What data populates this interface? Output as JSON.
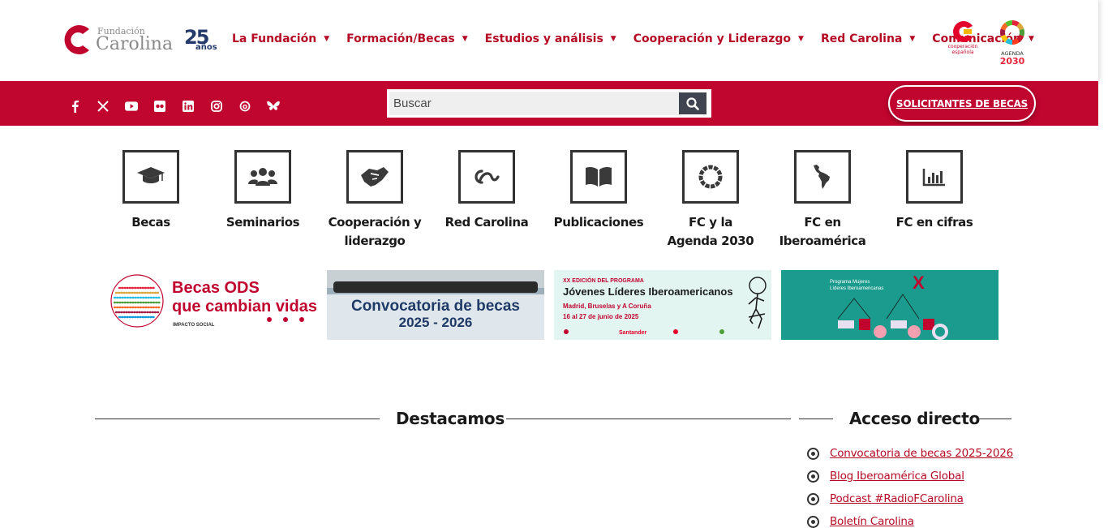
{
  "colors": {
    "brand_red": "#c0052f",
    "nav_red": "#b50b24",
    "dark": "#1a1a1a",
    "search_button": "#3f4450"
  },
  "header": {
    "logo": {
      "small": "Fundación",
      "big": "Carolina"
    },
    "anniversary": {
      "number": "25",
      "word": "años"
    },
    "nav": [
      {
        "label": "La Fundación",
        "icon": "caret-down-icon"
      },
      {
        "label": "Formación/Becas",
        "icon": "caret-down-icon"
      },
      {
        "label": "Estudios y análisis",
        "icon": "caret-down-icon"
      },
      {
        "label": "Cooperación y Liderazgo",
        "icon": "caret-down-icon"
      },
      {
        "label": "Red Carolina",
        "icon": "caret-down-icon"
      },
      {
        "label": "Comunicación",
        "icon": "caret-down-icon"
      }
    ],
    "cooperacion_logo": {
      "line1": "cooperación",
      "line2": "española"
    },
    "agenda_logo": {
      "line1": "AGENDA",
      "line2": "2030"
    }
  },
  "redbar": {
    "socials": [
      "facebook-icon",
      "x-icon",
      "youtube-icon",
      "flickr-icon",
      "linkedin-icon",
      "instagram-icon",
      "threads-icon",
      "bluesky-icon"
    ],
    "search": {
      "placeholder": "Buscar",
      "icon": "search-icon"
    },
    "apply_button": "SOLICITANTES DE BECAS"
  },
  "tiles": [
    {
      "label": "Becas",
      "icon": "graduation-cap-icon"
    },
    {
      "label": "Seminarios",
      "icon": "users-icon"
    },
    {
      "label": "Cooperación y liderazgo",
      "icon": "handshake-icon"
    },
    {
      "label": "Red Carolina",
      "icon": "red-carolina-icon"
    },
    {
      "label": "Publicaciones",
      "icon": "book-icon"
    },
    {
      "label": "FC y la Agenda 2030",
      "icon": "sdg-wheel-icon"
    },
    {
      "label": "FC en Iberoamérica",
      "icon": "latin-america-map-icon"
    },
    {
      "label": "FC en cifras",
      "icon": "bar-chart-icon"
    }
  ],
  "banners": {
    "b1": {
      "line1": "Becas ODS",
      "line2": "que cambian vidas",
      "tag": "IMPACTO SOCIAL"
    },
    "b2": {
      "line1": "Convocatoria de becas",
      "line2": "2025 - 2026"
    },
    "b3": {
      "kicker": "XX EDICIÓN DEL PROGRAMA",
      "title": "Jóvenes Líderes Iberoamericanos",
      "line1": "Madrid, Bruselas y A Coruña",
      "line2": "16 al 27 de junio de 2025",
      "sponsor": "Santander"
    },
    "b4": {
      "line1": "Programa Mujeres",
      "line2": "Líderes Iberoamericanas",
      "roman": "X"
    }
  },
  "sections": {
    "featured_title": "Destacamos",
    "quick_title": "Acceso directo",
    "quick_links": [
      "Convocatoria de becas 2025-2026",
      "Blog Iberoamérica Global",
      "Podcast #RadioFCarolina",
      "Boletín Carolina"
    ]
  }
}
